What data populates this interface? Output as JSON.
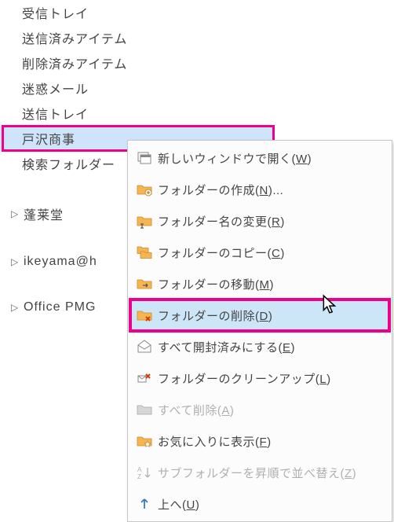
{
  "folders": {
    "inbox": "受信トレイ",
    "sent": "送信済みアイテム",
    "deleted": "削除済みアイテム",
    "junk": "迷惑メール",
    "outbox": "送信トレイ",
    "custom_selected": "戸沢商事",
    "search": "検索フォルダー"
  },
  "tree": {
    "item1": "蓬莱堂",
    "item2": "ikeyama@h",
    "item3": "Office PMG"
  },
  "context_menu": {
    "open_new_window": "新しいウィンドウで開く(W)",
    "create_folder": "フォルダーの作成(N)...",
    "rename_folder": "フォルダー名の変更(R)",
    "copy_folder": "フォルダーのコピー(C)",
    "move_folder": "フォルダーの移動(M)",
    "delete_folder": "フォルダーの削除(D)",
    "mark_all_read": "すべて開封済みにする(E)",
    "cleanup_folder": "フォルダーのクリーンアップ(L)",
    "delete_all": "すべて削除(A)",
    "show_favorites": "お気に入りに表示(F)",
    "sort_subfolders": "サブフォルダーを昇順で並べ替え(Z)",
    "move_up": "上へ(U)"
  }
}
